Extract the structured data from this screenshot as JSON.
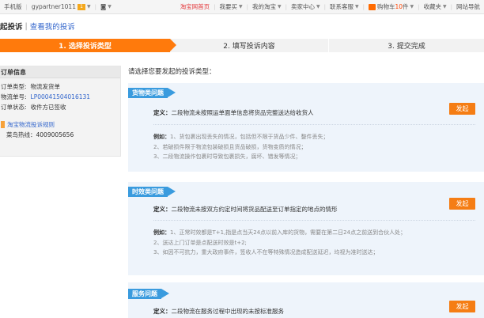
{
  "topbar": {
    "items": [
      {
        "label": "手机版",
        "style": "normal"
      },
      {
        "label": "gypartner1011",
        "style": "normal",
        "has_msg": true,
        "msg_count": "1",
        "caret": true
      },
      {
        "label": "◙",
        "style": "normal",
        "caret": true
      },
      {
        "label": "淘宝网首页",
        "style": "red"
      },
      {
        "label": "我要买",
        "style": "normal",
        "caret": true
      },
      {
        "label": "我的淘宝",
        "style": "normal",
        "caret": true
      },
      {
        "label": "卖家中心",
        "style": "normal",
        "caret": true
      },
      {
        "label": "联系客服",
        "style": "normal",
        "caret": true
      },
      {
        "label": "购物车",
        "style": "cart",
        "count": "10",
        "unit": "件",
        "caret": true
      },
      {
        "label": "收藏夹",
        "style": "normal",
        "caret": true
      },
      {
        "label": "网站导航",
        "style": "normal"
      }
    ]
  },
  "header": {
    "title": "起投诉",
    "separator": "|",
    "link": "查看我的投诉"
  },
  "steps": [
    "1. 选择投诉类型",
    "2. 填写投诉内容",
    "3. 提交完成"
  ],
  "order": {
    "heading": "订单信息",
    "rows": [
      {
        "key": "订单类型:",
        "value": "物流发货单",
        "blue": false
      },
      {
        "key": "物流单号:",
        "value": "LP00041504016131",
        "blue": true
      },
      {
        "key": "订单状态:",
        "value": "收件方已签收",
        "blue": false
      }
    ],
    "rules_link": "淘宝物流投诉规则",
    "hotline": "菜鸟热线：4009005656"
  },
  "main": {
    "prompt": "请选择您要发起的投诉类型：",
    "categories": [
      {
        "tag": "货物类问题",
        "definition_label": "定义：",
        "definition": "二段物流未按照运单面单信息将货品完整送达给收货人",
        "button": "发起",
        "example_label": "例如：",
        "examples": [
          "1、货包裹出现丢失的情况，包括但不限于货品少件、整件丢失；",
          "2、若破损件限于物流包装破损且货品破损，货物变质的情况；",
          "3、二段物流操作包裹时导致包裹损失，腐坏、错发等情况；"
        ]
      },
      {
        "tag": "时效类问题",
        "definition_label": "定义：",
        "definition": "二段物流未按双方约定时间将货品配送至订单指定的地点的情形",
        "button": "发起",
        "example_label": "例如：",
        "examples": [
          "1、正常时效都是T+1,指是点当天24点以前入库的货物，需要在第二日24点之前送到合伙人处；",
          "2、送达上门订单是点配送时效是t+2;",
          "3、如因不可抗力，重大政府事件，签收人不在等特殊情况造成配送延迟，均视为准时送达；"
        ]
      },
      {
        "tag": "服务问题",
        "definition_label": "定义：",
        "definition": "二段物流在服务过程中出现的未按标准服务",
        "button": "发起",
        "example_label": "",
        "examples": []
      }
    ]
  },
  "colors": {
    "accent_orange": "#ff7a0c",
    "button_orange": "#f57d14",
    "tag_blue": "#3a9bde",
    "link_blue": "#3366cc",
    "panel_bg": "#eef4fb",
    "top_red": "#e4393c"
  }
}
